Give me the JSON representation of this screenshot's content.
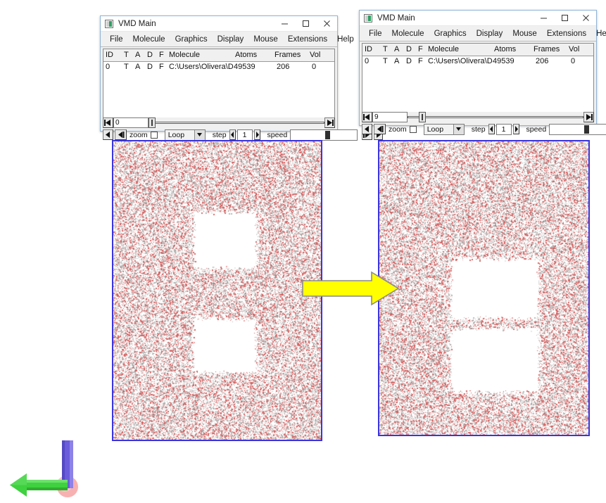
{
  "window_title": "VMD Main",
  "windows": [
    {
      "id": "left",
      "title": "VMD Main",
      "icon": "vmd-app-icon",
      "controls": {
        "minimize": "–",
        "maximize": "□",
        "close": "✕"
      },
      "menus": [
        "File",
        "Molecule",
        "Graphics",
        "Display",
        "Mouse",
        "Extensions",
        "Help"
      ],
      "table": {
        "columns": [
          "ID",
          "T",
          "A",
          "D",
          "F",
          "Molecule",
          "Atoms",
          "Frames",
          "Vol"
        ],
        "rows": [
          {
            "id": "0",
            "t": "T",
            "a": "A",
            "d": "D",
            "f": "F",
            "molecule": "C:\\Users\\Olivera\\Desktop",
            "atoms": "49539",
            "frames": "206",
            "vol": "0"
          }
        ]
      },
      "transport": {
        "frame_value": "0",
        "zoom_label": "zoom",
        "zoom_checked": false,
        "loop_mode": "Loop",
        "step_label": "step",
        "step_value": "1",
        "speed_label": "speed"
      }
    },
    {
      "id": "right",
      "title": "VMD Main",
      "icon": "vmd-app-icon",
      "controls": {
        "minimize": "–",
        "maximize": "□",
        "close": "✕"
      },
      "menus": [
        "File",
        "Molecule",
        "Graphics",
        "Display",
        "Mouse",
        "Extensions",
        "Help"
      ],
      "table": {
        "columns": [
          "ID",
          "T",
          "A",
          "D",
          "F",
          "Molecule",
          "Atoms",
          "Frames",
          "Vol"
        ],
        "rows": [
          {
            "id": "0",
            "t": "T",
            "a": "A",
            "d": "D",
            "f": "F",
            "molecule": "C:\\Users\\Olivera\\Desktop",
            "atoms": "49539",
            "frames": "206",
            "vol": "0"
          }
        ]
      },
      "transport": {
        "frame_value": "9",
        "zoom_label": "zoom",
        "zoom_checked": false,
        "loop_mode": "Loop",
        "step_label": "step",
        "step_value": "1",
        "speed_label": "speed"
      }
    }
  ],
  "renders": {
    "left": {
      "name": "initial-state-render",
      "box_color": "#3a34e0",
      "cavities": [
        {
          "label": "upper-cavity"
        },
        {
          "label": "lower-cavity"
        }
      ]
    },
    "right": {
      "name": "final-state-render",
      "box_color": "#3a34e0",
      "cavities": [
        {
          "label": "upper-cavity"
        },
        {
          "label": "lower-cavity"
        }
      ]
    }
  },
  "transition_arrow": {
    "name": "transition-arrow",
    "direction": "right",
    "fill": "#ffff00",
    "stroke": "#808080"
  },
  "axes_widget": {
    "name": "axes-indicator",
    "x_axis_color": "#3fd13f",
    "y_axis_color": "#6a5cdb",
    "z_axis_color": "#f4a7a7"
  }
}
